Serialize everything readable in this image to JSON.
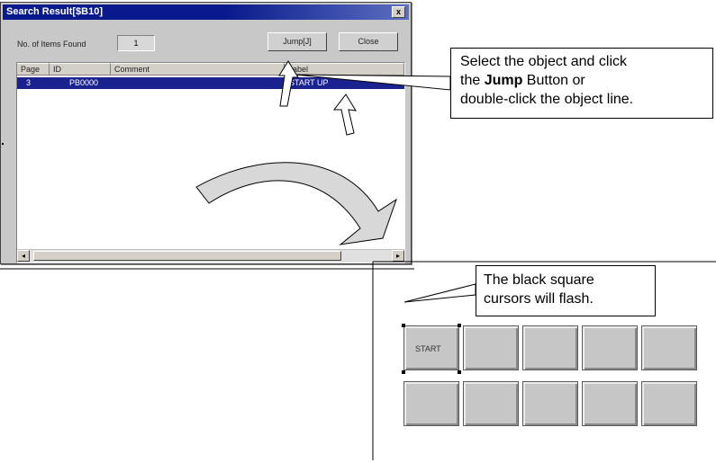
{
  "dialog": {
    "title": "Search Result[$B10]",
    "close_glyph": "x",
    "items_found_label": "No. of Items Found",
    "items_found_value": "1",
    "jump_button": "Jump[J]",
    "close_button": "Close"
  },
  "list": {
    "columns": [
      "Page",
      "ID",
      "Comment",
      "Label"
    ],
    "rows": [
      {
        "page": "3",
        "id": "PB0000",
        "comment": "",
        "label": "START UP"
      }
    ],
    "selected_row": 0
  },
  "scrollbar": {
    "left_arrow": "◂",
    "right_arrow": "▸"
  },
  "callout_jump": {
    "line1": "Select the object and click",
    "line2_prefix": "the ",
    "line2_bold": "Jump",
    "line2_suffix": " Button or",
    "line3": "double-click the object line."
  },
  "callout_cursor": {
    "line1": "The black square",
    "line2": "cursors will flash."
  },
  "panel": {
    "first_button_label": "START",
    "rows": 2,
    "cols": 5
  },
  "colors": {
    "title_bar": "#0a1a8c",
    "selection": "#1a228f",
    "window_face": "#c8c8c8",
    "panel_button": "#c6c6c6"
  }
}
